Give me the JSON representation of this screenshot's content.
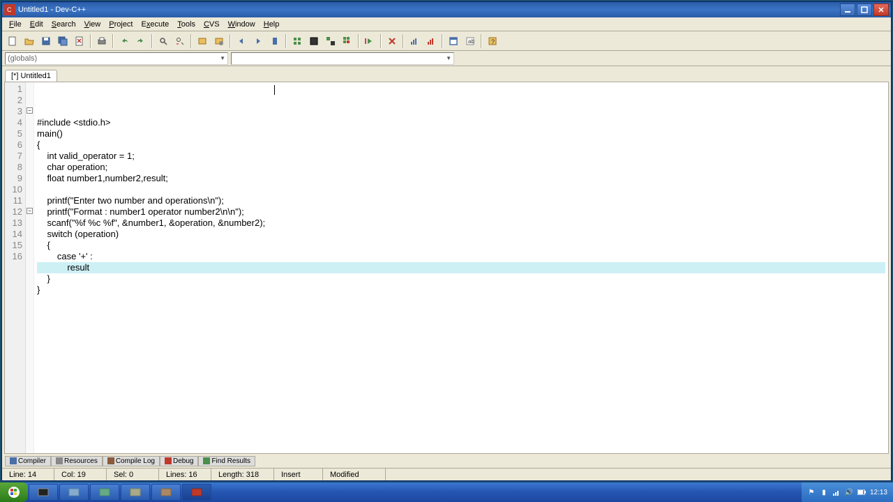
{
  "title": "Untitled1 - Dev-C++",
  "menu": [
    "File",
    "Edit",
    "Search",
    "View",
    "Project",
    "Execute",
    "Tools",
    "CVS",
    "Window",
    "Help"
  ],
  "combo1": "(globals)",
  "combo2": "",
  "tab": "[*] Untitled1",
  "code_lines": [
    "#include <stdio.h>",
    "main()",
    "{",
    "    int valid_operator = 1;",
    "    char operation;",
    "    float number1,number2,result;",
    "",
    "    printf(\"Enter two number and operations\\n\");",
    "    printf(\"Format : number1 operator number2\\n\\n\");",
    "    scanf(\"%f %c %f\", &number1, &operation, &number2);",
    "    switch (operation)",
    "    {",
    "        case '+' :",
    "            result",
    "    }",
    "}"
  ],
  "highlight_line": 14,
  "bottom_tabs": [
    "Compiler",
    "Resources",
    "Compile Log",
    "Debug",
    "Find Results"
  ],
  "status": {
    "line": "Line: 14",
    "col": "Col: 19",
    "sel": "Sel: 0",
    "lines": "Lines: 16",
    "length": "Length: 318",
    "mode": "Insert",
    "modified": "Modified"
  },
  "clock": "12:13"
}
